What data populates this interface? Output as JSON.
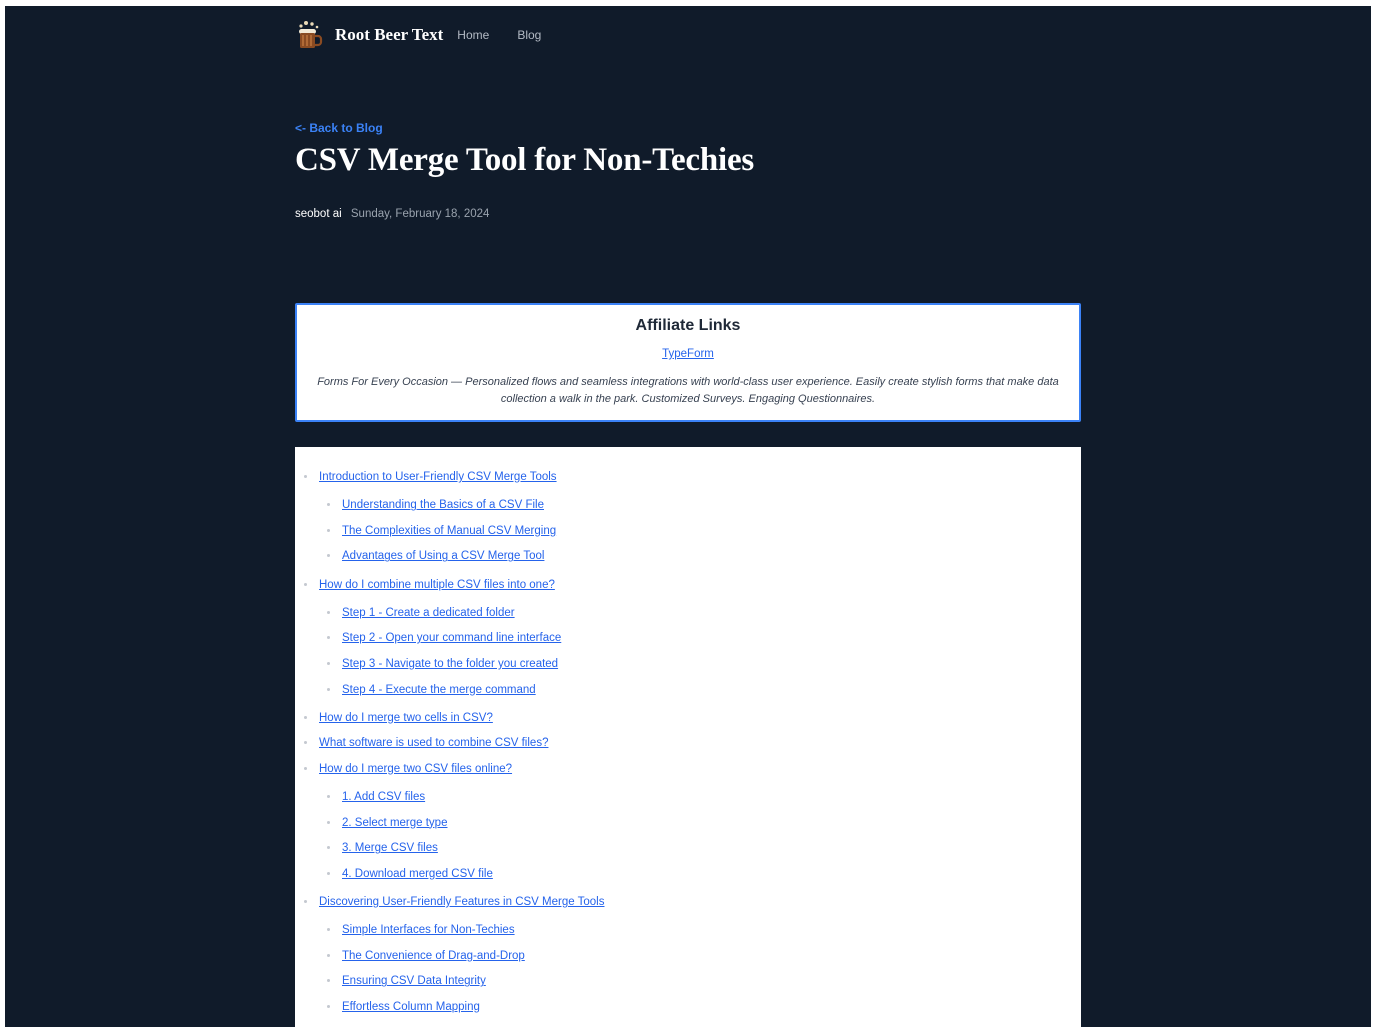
{
  "header": {
    "brand": "Root Beer Text",
    "logo_icon": "root-beer-mug-icon",
    "nav": [
      {
        "label": "Home"
      },
      {
        "label": "Blog"
      }
    ]
  },
  "post": {
    "back_link": "<- Back to Blog",
    "title": "CSV Merge Tool for Non-Techies",
    "author": "seobot ai",
    "date": "Sunday, February 18, 2024"
  },
  "affiliate": {
    "heading": "Affiliate Links",
    "link": "TypeForm",
    "description": "Forms For Every Occasion — Personalized flows and seamless integrations with world-class user experience. Easily create stylish forms that make data collection a walk in the park. Customized Surveys. Engaging Questionnaires."
  },
  "colors": {
    "background": "#101b2a",
    "accent": "#3b82f6",
    "link": "#2563eb"
  },
  "toc": [
    {
      "level": 1,
      "label": "Introduction to User-Friendly CSV Merge Tools"
    },
    {
      "level": 2,
      "label": "Understanding the Basics of a CSV File"
    },
    {
      "level": 2,
      "label": "The Complexities of Manual CSV Merging"
    },
    {
      "level": 2,
      "label": "Advantages of Using a CSV Merge Tool"
    },
    {
      "level": 1,
      "label": "How do I combine multiple CSV files into one?"
    },
    {
      "level": 2,
      "label": "Step 1 - Create a dedicated folder"
    },
    {
      "level": 2,
      "label": "Step 2 - Open your command line interface"
    },
    {
      "level": 2,
      "label": "Step 3 - Navigate to the folder you created"
    },
    {
      "level": 2,
      "label": "Step 4 - Execute the merge command"
    },
    {
      "level": 1,
      "label": "How do I merge two cells in CSV?"
    },
    {
      "level": 1,
      "label": "What software is used to combine CSV files?"
    },
    {
      "level": 1,
      "label": "How do I merge two CSV files online?"
    },
    {
      "level": 2,
      "label": "1. Add CSV files"
    },
    {
      "level": 2,
      "label": "2. Select merge type"
    },
    {
      "level": 2,
      "label": "3. Merge CSV files"
    },
    {
      "level": 2,
      "label": "4. Download merged CSV file"
    },
    {
      "level": 1,
      "label": "Discovering User-Friendly Features in CSV Merge Tools"
    },
    {
      "level": 2,
      "label": "Simple Interfaces for Non-Techies"
    },
    {
      "level": 2,
      "label": "The Convenience of Drag-and-Drop"
    },
    {
      "level": 2,
      "label": "Ensuring CSV Data Integrity"
    },
    {
      "level": 2,
      "label": "Effortless Column Mapping"
    }
  ]
}
